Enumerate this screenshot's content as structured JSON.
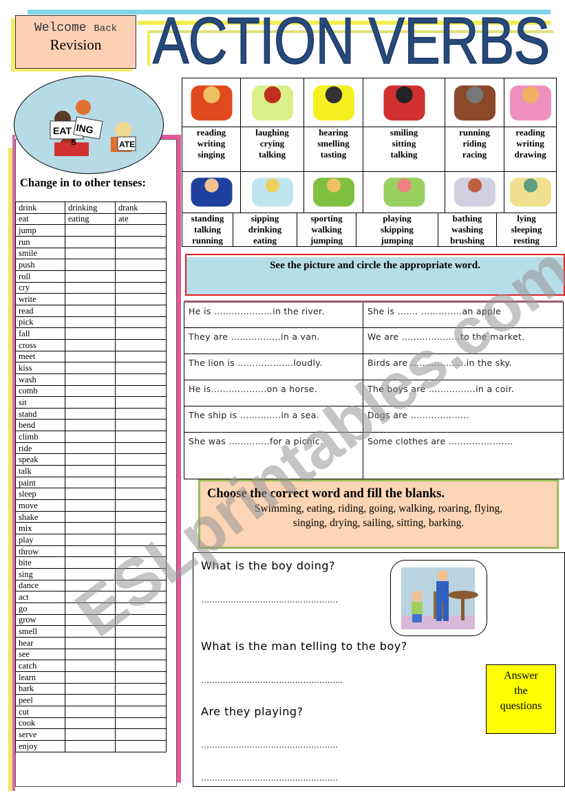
{
  "header": {
    "welcome": "Welcome",
    "back": "Back",
    "revision": "Revision",
    "title": "ACTION VERBS"
  },
  "logo": {
    "labels": [
      "EAT",
      "ING",
      "S",
      "ATE"
    ]
  },
  "tenses": {
    "heading": "Change in to other tenses:",
    "rows": [
      [
        "drink",
        "drinking",
        "drank"
      ],
      [
        "eat",
        "eating",
        "ate"
      ],
      [
        "jump",
        "",
        ""
      ],
      [
        "run",
        "",
        ""
      ],
      [
        "smile",
        "",
        ""
      ],
      [
        "push",
        "",
        ""
      ],
      [
        "roll",
        "",
        ""
      ],
      [
        "cry",
        "",
        ""
      ],
      [
        "write",
        "",
        ""
      ],
      [
        "read",
        "",
        ""
      ],
      [
        "pick",
        "",
        ""
      ],
      [
        "fall",
        "",
        ""
      ],
      [
        "cross",
        "",
        ""
      ],
      [
        "meet",
        "",
        ""
      ],
      [
        "kiss",
        "",
        ""
      ],
      [
        "wash",
        "",
        ""
      ],
      [
        "comb",
        "",
        ""
      ],
      [
        "sit",
        "",
        ""
      ],
      [
        "stand",
        "",
        ""
      ],
      [
        "bend",
        "",
        ""
      ],
      [
        "climb",
        "",
        ""
      ],
      [
        "ride",
        "",
        ""
      ],
      [
        "speak",
        "",
        ""
      ],
      [
        "talk",
        "",
        ""
      ],
      [
        "paint",
        "",
        ""
      ],
      [
        "sleep",
        "",
        ""
      ],
      [
        "move",
        "",
        ""
      ],
      [
        "shake",
        "",
        ""
      ],
      [
        "mix",
        "",
        ""
      ],
      [
        "play",
        "",
        ""
      ],
      [
        "throw",
        "",
        ""
      ],
      [
        "bite",
        "",
        ""
      ],
      [
        "sing",
        "",
        ""
      ],
      [
        "dance",
        "",
        ""
      ],
      [
        "act",
        "",
        ""
      ],
      [
        "go",
        "",
        ""
      ],
      [
        "grow",
        "",
        ""
      ],
      [
        "smell",
        "",
        ""
      ],
      [
        "hear",
        "",
        ""
      ],
      [
        "see",
        "",
        ""
      ],
      [
        "catch",
        "",
        ""
      ],
      [
        "learn",
        "",
        ""
      ],
      [
        "bark",
        "",
        ""
      ],
      [
        "peel",
        "",
        ""
      ],
      [
        "cut",
        "",
        ""
      ],
      [
        "cook",
        "",
        ""
      ],
      [
        "serve",
        "",
        ""
      ],
      [
        "enjoy",
        "",
        ""
      ]
    ]
  },
  "verb_pictures": {
    "row1": [
      {
        "picture": "boy-reading",
        "words": [
          "reading",
          "writing",
          "singing"
        ]
      },
      {
        "picture": "girl-crying",
        "words": [
          "laughing",
          "crying",
          "talking"
        ]
      },
      {
        "picture": "face-hand-ear",
        "words": [
          "hearing",
          "smelling",
          "tasting"
        ]
      },
      {
        "picture": "boy-sitting",
        "words": [
          "smiling",
          "sitting",
          "talking"
        ]
      },
      {
        "picture": "boy-riding-horse",
        "words": [
          "running",
          "riding",
          "racing"
        ]
      },
      {
        "picture": "girl-drawing",
        "words": [
          "reading",
          "writing",
          "drawing"
        ]
      }
    ],
    "row2": [
      {
        "picture": "man-on-phone",
        "words": [
          "standing",
          "talking",
          "running"
        ]
      },
      {
        "picture": "girl-drinking",
        "words": [
          "sipping",
          "drinking",
          "eating"
        ]
      },
      {
        "picture": "sack-race",
        "words": [
          "sporting",
          "walking",
          "jumping"
        ]
      },
      {
        "picture": "skipping-rope",
        "words": [
          "playing",
          "skipping",
          "jumping"
        ]
      },
      {
        "picture": "boy-washing",
        "words": [
          "bathing",
          "washing",
          "brushing"
        ]
      },
      {
        "picture": "child-sleeping",
        "words": [
          "lying",
          "sleeping",
          "resting"
        ]
      }
    ]
  },
  "exercise1": {
    "instruction": "See the picture and circle the appropriate word.",
    "sentences": [
      [
        "He is  ………………..in the river.",
        "She is ……. …………..an apple"
      ],
      [
        "They are ……………..in a van.",
        "We are ………………..to the market."
      ],
      [
        "The lion is ……………….loudly.",
        "Birds are ……………....in the sky."
      ],
      [
        "He is……………….on a horse.",
        "The boys are …………....in a coir."
      ],
      [
        "The ship is …………..in a sea.",
        "Dogs are ……………….."
      ],
      [
        "She was …………..for a picnic.",
        "Some clothes are …………………."
      ]
    ]
  },
  "exercise2": {
    "instruction": "Choose the correct word and fill the blanks.",
    "words_line1": "Swimming, eating, riding, going, walking, roaring, flying,",
    "words_line2": "singing, drying, sailing, sitting, barking."
  },
  "exercise3": {
    "questions": [
      "What is the boy doing?",
      "What is the man telling to the boy?",
      "Are they playing?"
    ],
    "answer_lines": [
      "……………………………………………",
      "……………………………………………..",
      "……………………………………………",
      "……………………………………………"
    ],
    "picture": "man-and-boy-at-table",
    "note": "Answer the questions",
    "note_lines": [
      "Answer",
      "the",
      "questions"
    ]
  },
  "watermark": "ESLprintables.com",
  "colors": {
    "title": "#274a7c",
    "peach": "#fbd0b5",
    "instruction_border": "#e02020",
    "instruction_bg": "#b7dde8",
    "green_border": "#9bbb59",
    "note_bg": "#ffff00",
    "ellipse": "#b7dbe6",
    "pink_frame": "#e8559a"
  }
}
